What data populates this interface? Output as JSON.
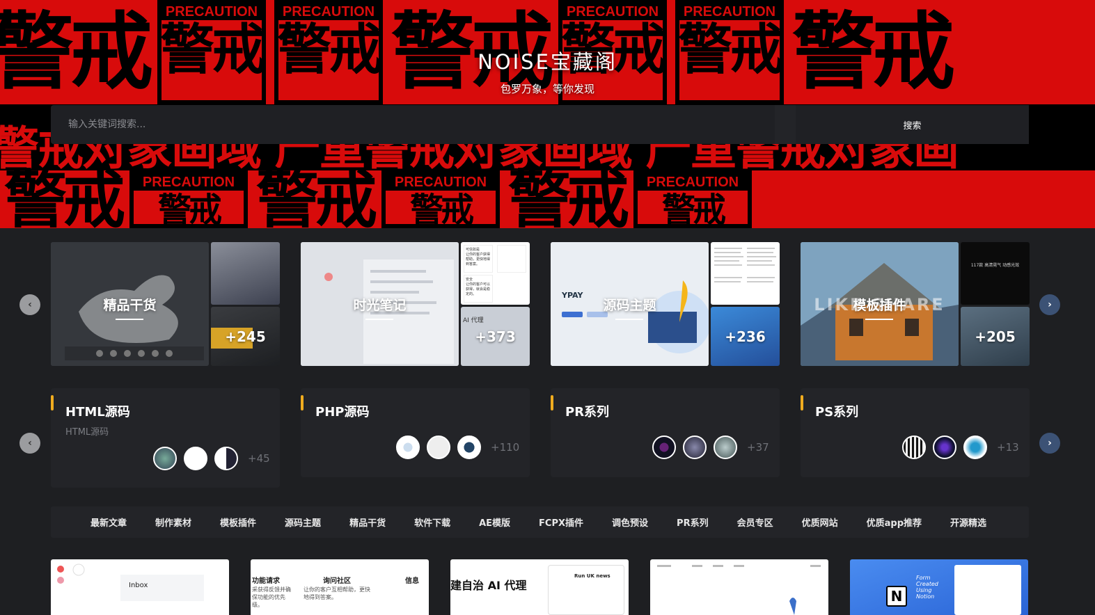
{
  "hero": {
    "site_name": "NOISE宝藏阁",
    "tagline": "包罗万象，等你发现",
    "bg_big": "警戒",
    "bg_precaution": "PRECAUTION",
    "bg_strip": "警戒对象画域 严重警戒对象画域 严重警戒对象画",
    "accent_red": "#d80b0b"
  },
  "search": {
    "placeholder": "输入关键词搜索...",
    "button_label": "搜索"
  },
  "features": [
    {
      "label": "精品干货",
      "count": "+245"
    },
    {
      "label": "时光笔记",
      "count": "+373"
    },
    {
      "label": "源码主题",
      "count": "+236"
    },
    {
      "label": "模板插件",
      "count": "+205"
    }
  ],
  "feature_side_texts": {
    "card2_top": [
      "可信如是",
      "让你的客户获得帮助，更快地得到答案。",
      "安全",
      "让你的客户可以获得，就会是稳定的。"
    ],
    "card2_bot": "AI 代理",
    "card3_main": "YPAY",
    "card4_main": "LIKE SHARE",
    "card4_top": "117款 高清霓气 动感光效"
  },
  "categories": [
    {
      "title": "HTML源码",
      "subtitle": "HTML源码",
      "more": "+45"
    },
    {
      "title": "PHP源码",
      "subtitle": "",
      "more": "+110"
    },
    {
      "title": "PR系列",
      "subtitle": "",
      "more": "+37"
    },
    {
      "title": "PS系列",
      "subtitle": "",
      "more": "+13"
    }
  ],
  "arrows": {
    "left": "‹",
    "right": "›"
  },
  "menu": [
    "最新文章",
    "制作素材",
    "模板插件",
    "源码主题",
    "精品干货",
    "软件下载",
    "AE模版",
    "FCPX插件",
    "调色预设",
    "PR系列",
    "会员专区",
    "优质网站",
    "优质app推荐",
    "开源精选"
  ],
  "posts": {
    "p1": "Inbox",
    "p2": [
      "功能请求",
      "询问社区",
      "信息",
      "采获得反馈并确保功能的优先级。",
      "让你的客户互相帮助，更快地得到答案。"
    ],
    "p3_title": "建自治 AI 代理",
    "p3_news": "Run UK news",
    "p5": "Form Created Using Notion"
  }
}
